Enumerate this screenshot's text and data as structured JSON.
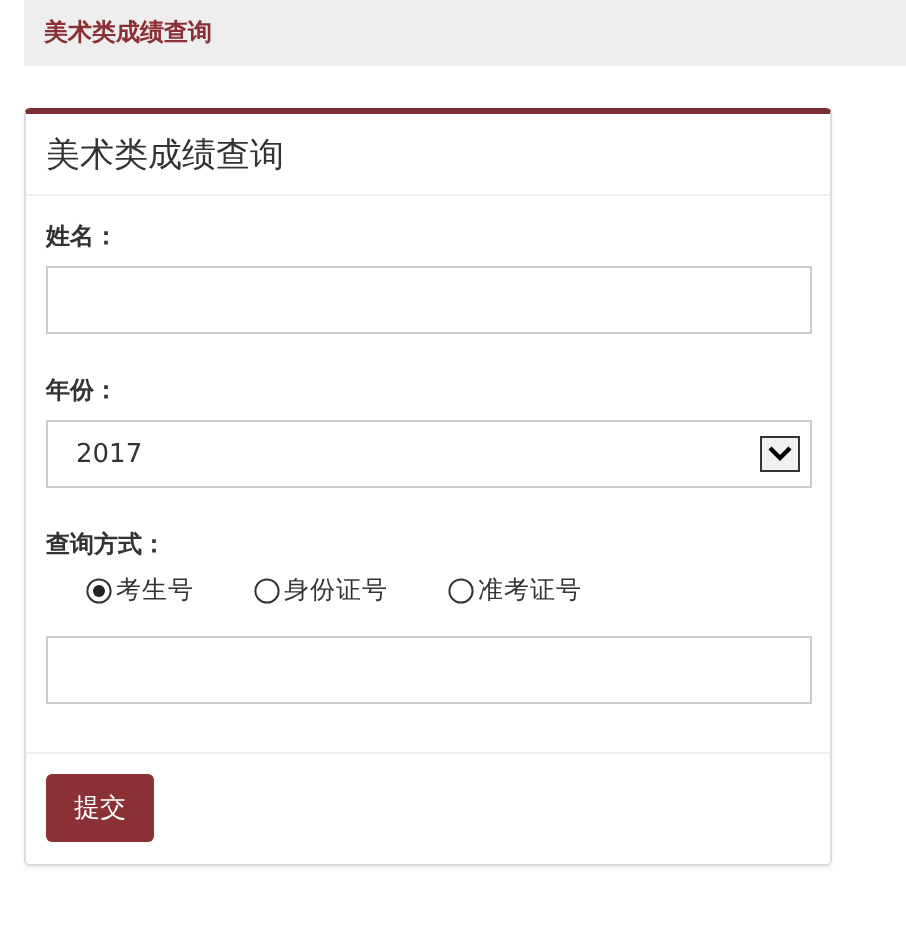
{
  "header": {
    "title": "美术类成绩查询"
  },
  "panel": {
    "title": "美术类成绩查询"
  },
  "name_field": {
    "label": "姓名："
  },
  "year_field": {
    "label": "年份：",
    "value": "2017"
  },
  "method_field": {
    "label": "查询方式：",
    "options": [
      {
        "label": "考生号",
        "selected": true
      },
      {
        "label": "身份证号",
        "selected": false
      },
      {
        "label": "准考证号",
        "selected": false
      }
    ]
  },
  "submit_button": {
    "label": "提交"
  }
}
